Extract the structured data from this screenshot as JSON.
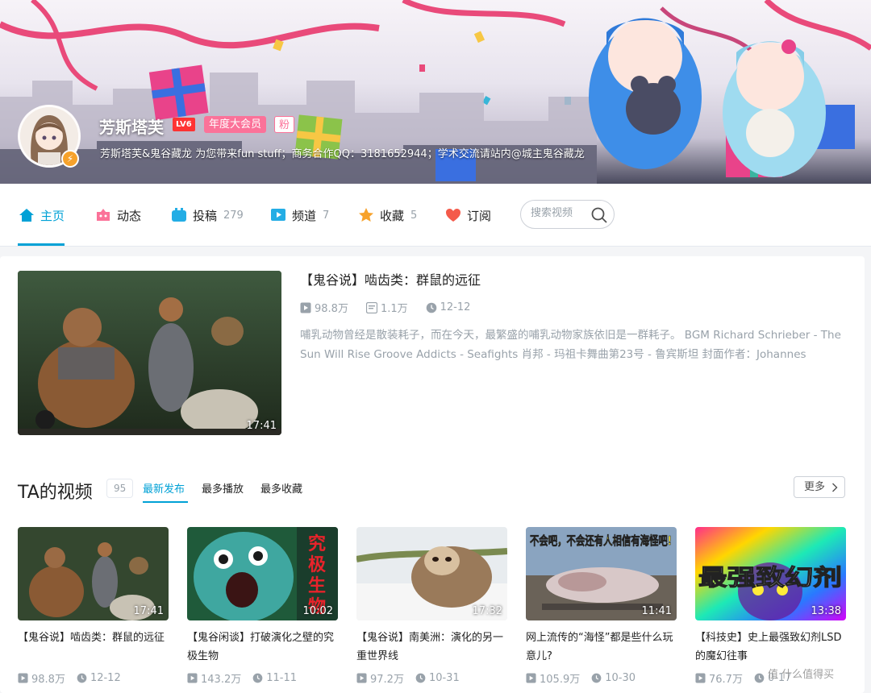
{
  "profile": {
    "name": "芳斯塔芙",
    "level": "LV6",
    "vip": "年度大会员",
    "fan_badge": "粉",
    "sign": "芳斯塔芙&鬼谷藏龙 为您带来fun stuff；商务合作QQ：3181652944；学术交流请站内@城主鬼谷藏龙"
  },
  "nav": {
    "items": [
      {
        "label": "主页",
        "count": ""
      },
      {
        "label": "动态",
        "count": ""
      },
      {
        "label": "投稿",
        "count": "279"
      },
      {
        "label": "频道",
        "count": "7"
      },
      {
        "label": "收藏",
        "count": "5"
      },
      {
        "label": "订阅",
        "count": ""
      }
    ],
    "search_placeholder": "搜索视频"
  },
  "featured": {
    "title": "【鬼谷说】啮齿类：群鼠的远征",
    "plays": "98.8万",
    "danmaku": "1.1万",
    "date": "12-12",
    "duration": "17:41",
    "description": "哺乳动物曾经是散装耗子，而在今天，最繁盛的哺乳动物家族依旧是一群耗子。 BGM Richard Schrieber - The Sun Will Rise Groove Addicts - Seafights 肖邦 - 玛祖卡舞曲第23号 - 鲁宾斯坦 封面作者：Johannes"
  },
  "videos_section": {
    "title": "TA的视频",
    "count": "95",
    "sorts": [
      "最新发布",
      "最多播放",
      "最多收藏"
    ],
    "more": "更多"
  },
  "videos": [
    {
      "title": "【鬼谷说】啮齿类：群鼠的远征",
      "plays": "98.8万",
      "date": "12-12",
      "duration": "17:41",
      "overlay": ""
    },
    {
      "title": "【鬼谷闲谈】打破演化之壁的究极生物",
      "plays": "143.2万",
      "date": "11-11",
      "duration": "10:02",
      "overlay": "究极生物"
    },
    {
      "title": "【鬼谷说】南美洲：演化的另一重世界线",
      "plays": "97.2万",
      "date": "10-31",
      "duration": "17:32",
      "overlay": ""
    },
    {
      "title": "网上流传的“海怪”都是些什么玩意儿?",
      "plays": "105.9万",
      "date": "10-30",
      "duration": "11:41",
      "overlay": "不会吧，不会还有人相信有海怪吧!"
    },
    {
      "title": "【科技史】史上最强致幻剂LSD的魔幻往事",
      "plays": "76.7万",
      "date": "0-17",
      "duration": "13:38",
      "overlay": "最强致幻剂"
    }
  ],
  "watermark": "值 什么值得买",
  "colors": {
    "accent": "#00a1d6",
    "pink": "#fb7299",
    "muted": "#99a2aa"
  }
}
